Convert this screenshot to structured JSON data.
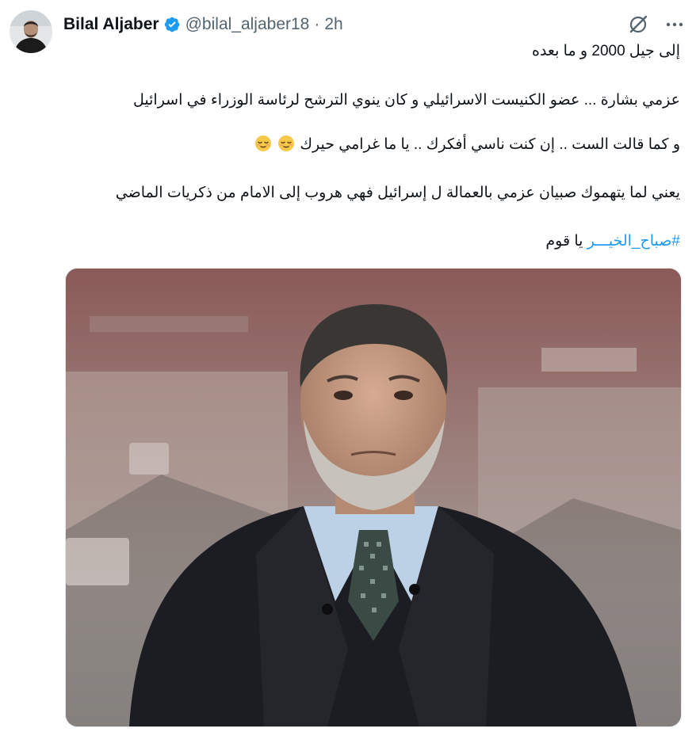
{
  "author": {
    "display_name": "Bilal Aljaber",
    "handle": "@bilal_aljaber18",
    "separator": "·",
    "time": "2h",
    "verified": true
  },
  "header_icons": {
    "grok": "grok-icon",
    "more": "more-icon"
  },
  "tweet": {
    "line1": "إلى جيل 2000 و ما بعده",
    "line2": "عزمي بشارة ... عضو الكنيست الاسرائيلي و كان ينوي الترشح لرئاسة الوزراء في اسرائيل",
    "line3": "و كما قالت الست .. إن كنت ناسي أفكرك .. يا ما غرامي حيرك",
    "line4": "يعني لما يتهموك صبيان عزمي بالعمالة ل إسرائيل فهي هروب إلى الامام من ذكريات الماضي",
    "hashtag": "#صباح_الخيـــر",
    "line5_rest": " يا قوم",
    "emoji": "relieved-face-emoji"
  },
  "colors": {
    "link": "#1d9bf0",
    "verified": "#1d9bf0",
    "secondary_text": "#536471"
  }
}
